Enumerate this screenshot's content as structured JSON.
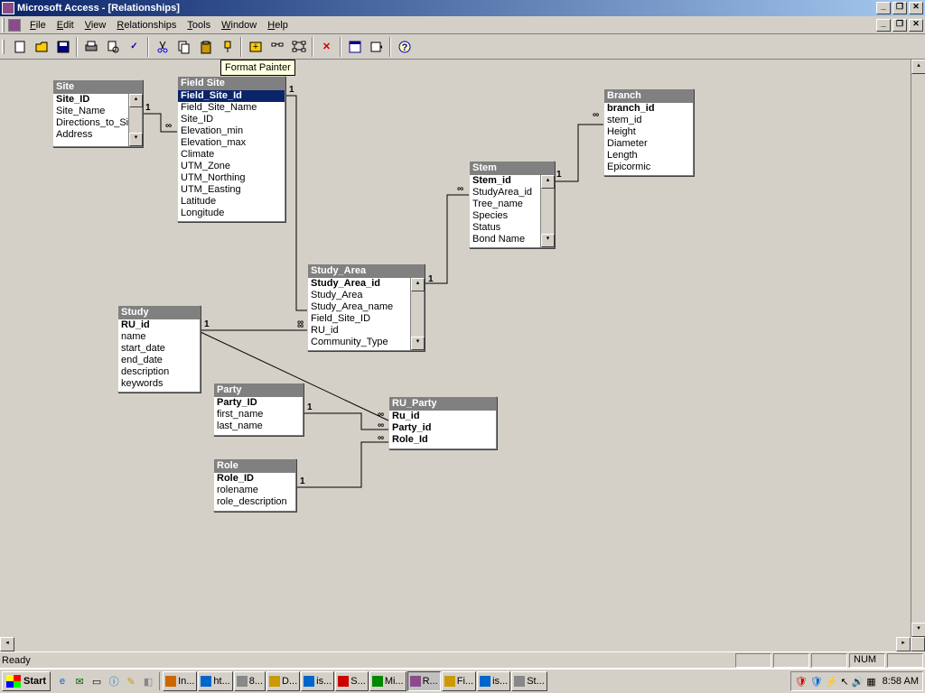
{
  "window": {
    "title": "Microsoft Access - [Relationships]"
  },
  "menu": {
    "file": "File",
    "edit": "Edit",
    "view": "View",
    "relationships": "Relationships",
    "tools": "Tools",
    "window": "Window",
    "help": "Help"
  },
  "tooltip": "Format Painter",
  "tables": {
    "site": {
      "title": "Site",
      "fields": [
        "Site_ID",
        "Site_Name",
        "Directions_to_Si",
        "Address"
      ],
      "pk": [
        0
      ]
    },
    "fieldsite": {
      "title": "Field Site",
      "fields": [
        "Field_Site_Id",
        "Field_Site_Name",
        "Site_ID",
        "Elevation_min",
        "Elevation_max",
        "Climate",
        "UTM_Zone",
        "UTM_Northing",
        "UTM_Easting",
        "Latitude",
        "Longitude"
      ],
      "pk": [
        0
      ],
      "sel": 0
    },
    "stem": {
      "title": "Stem",
      "fields": [
        "Stem_id",
        "StudyArea_id",
        "Tree_name",
        "Species",
        "Status",
        "Bond Name"
      ],
      "pk": [
        0
      ]
    },
    "branch": {
      "title": "Branch",
      "fields": [
        "branch_id",
        "stem_id",
        "Height",
        "Diameter",
        "Length",
        "Epicormic"
      ],
      "pk": [
        0
      ]
    },
    "studyarea": {
      "title": "Study_Area",
      "fields": [
        "Study_Area_id",
        "Study_Area",
        "Study_Area_name",
        "Field_Site_ID",
        "RU_id",
        "Community_Type"
      ],
      "pk": [
        0
      ]
    },
    "study": {
      "title": "Study",
      "fields": [
        "RU_id",
        "name",
        "start_date",
        "end_date",
        "description",
        "keywords"
      ],
      "pk": [
        0
      ]
    },
    "party": {
      "title": "Party",
      "fields": [
        "Party_ID",
        "first_name",
        "last_name"
      ],
      "pk": [
        0
      ]
    },
    "role": {
      "title": "Role",
      "fields": [
        "Role_ID",
        "rolename",
        "role_description"
      ],
      "pk": [
        0
      ]
    },
    "ruparty": {
      "title": "RU_Party",
      "fields": [
        "Ru_id",
        "Party_id",
        "Role_Id"
      ],
      "pk": [
        0,
        1,
        2
      ]
    }
  },
  "status": {
    "ready": "Ready",
    "num": "NUM"
  },
  "taskbar": {
    "start": "Start",
    "tasks": [
      "In...",
      "ht...",
      "8...",
      "D...",
      "is...",
      "S...",
      "Mi...",
      "R...",
      "Fi...",
      "is...",
      "St..."
    ],
    "activeTask": 7,
    "clock": "8:58 AM"
  }
}
